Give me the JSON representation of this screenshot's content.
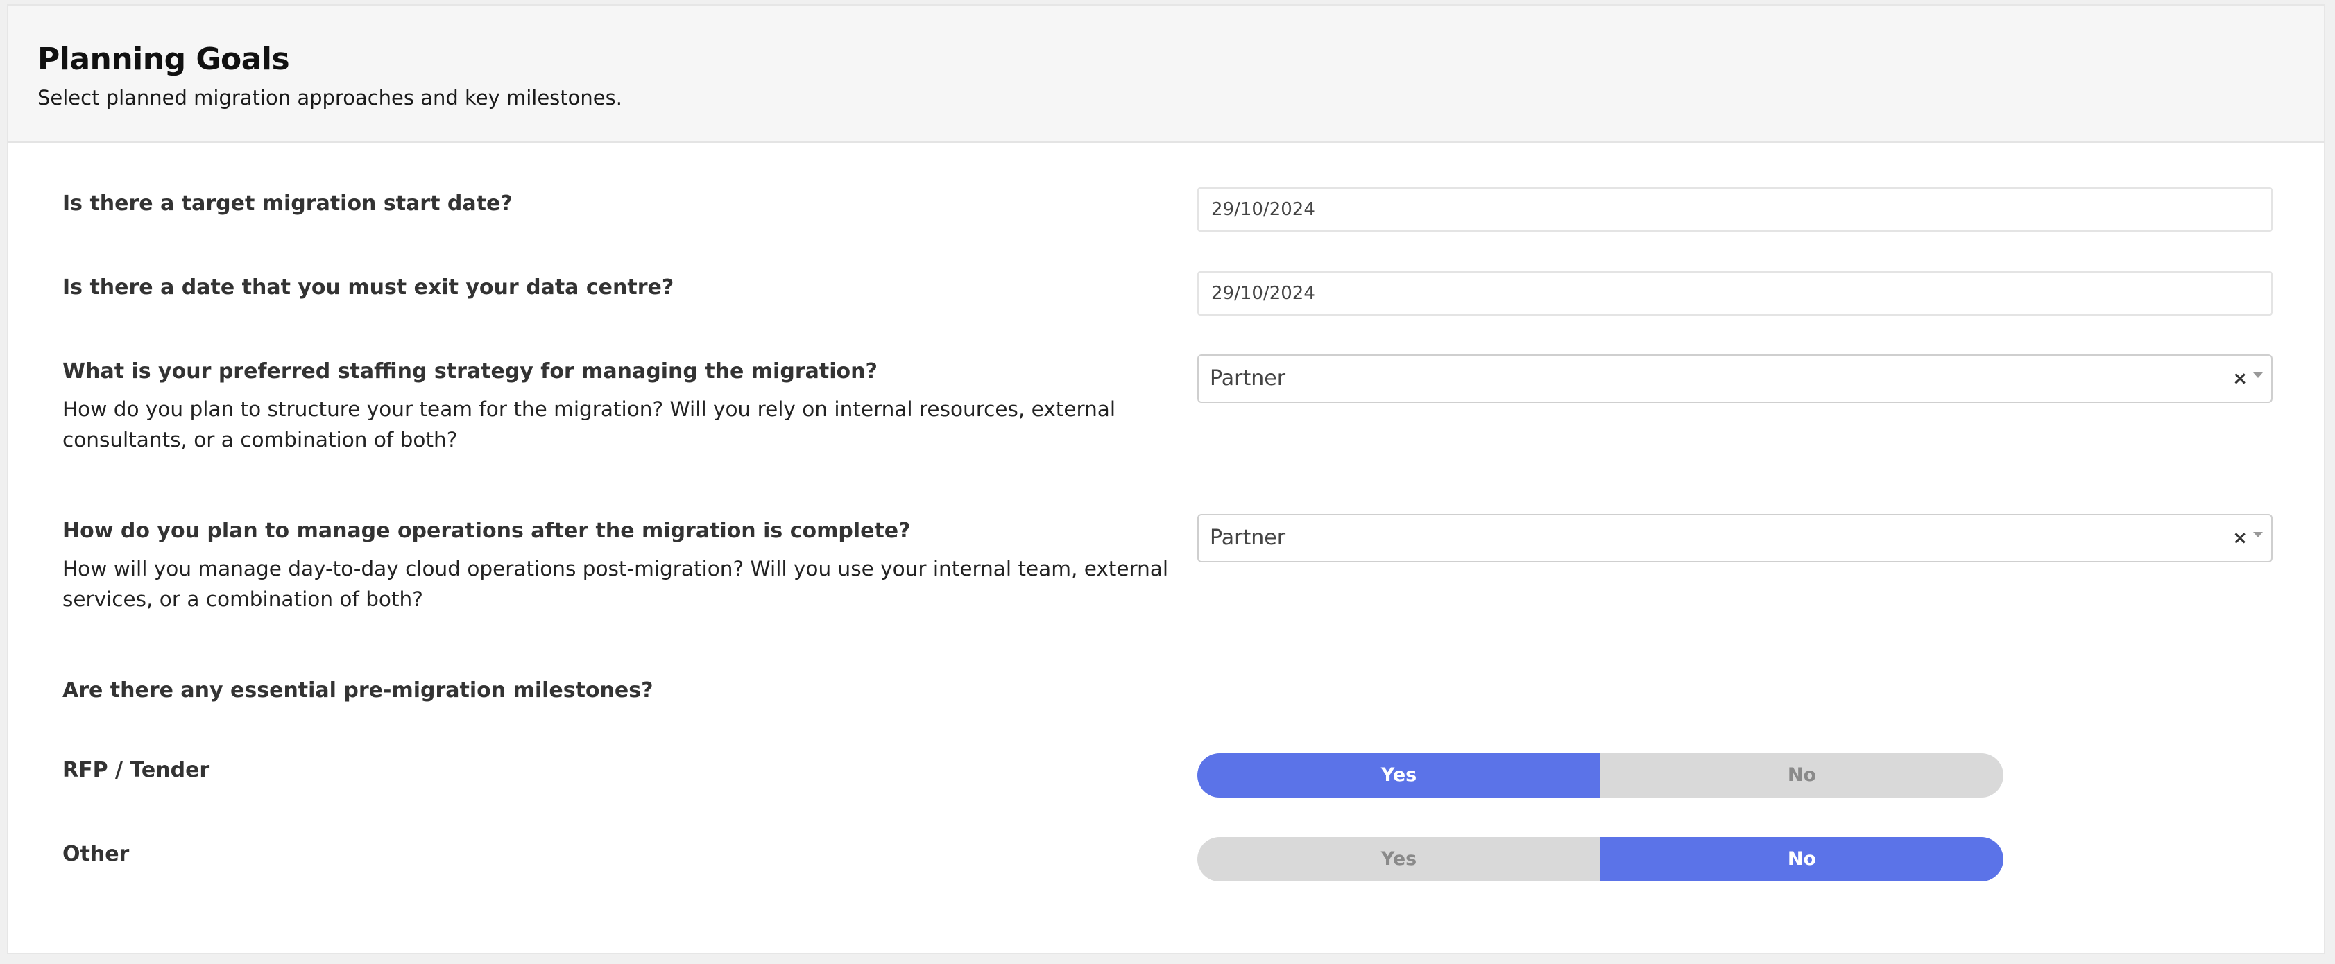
{
  "header": {
    "title": "Planning Goals",
    "subtitle": "Select planned migration approaches and key milestones."
  },
  "questions": {
    "start_date": {
      "label": "Is there a target migration start date?",
      "value": "29/10/2024"
    },
    "exit_date": {
      "label": "Is there a date that you must exit your data centre?",
      "value": "29/10/2024"
    },
    "staffing": {
      "label": "What is your preferred staffing strategy for managing the migration?",
      "description": "How do you plan to structure your team for the migration? Will you rely on internal resources, external consultants, or a combination of both?",
      "value": "Partner",
      "clear": "×"
    },
    "operations": {
      "label": "How do you plan to manage operations after the migration is complete?",
      "description": "How will you manage day-to-day cloud operations post-migration? Will you use your internal team, external services, or a combination of both?",
      "value": "Partner",
      "clear": "×"
    },
    "milestones": {
      "label": "Are there any essential pre-migration milestones?"
    },
    "rfp": {
      "label": "RFP / Tender",
      "yes": "Yes",
      "no": "No",
      "selected": "Yes"
    },
    "other": {
      "label": "Other",
      "yes": "Yes",
      "no": "No",
      "selected": "No"
    }
  },
  "colors": {
    "accent": "#5b73e8",
    "toggle_inactive": "#d9d9d9",
    "header_bg": "#f6f6f6"
  }
}
